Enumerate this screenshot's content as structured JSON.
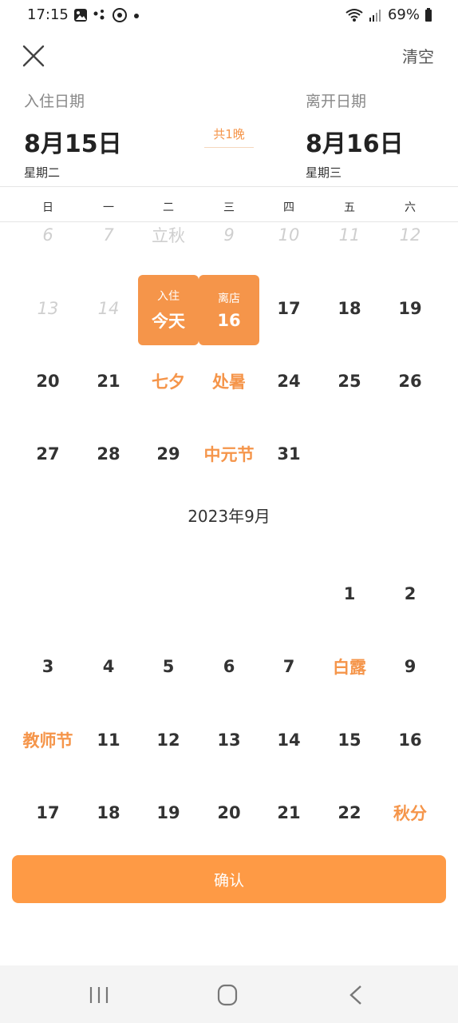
{
  "status_bar": {
    "time": "17:15",
    "battery": "69%"
  },
  "topbar": {
    "clear_label": "清空"
  },
  "checkin": {
    "label": "入住日期",
    "date": "8月15日",
    "weekday": "星期二"
  },
  "checkout": {
    "label": "离开日期",
    "date": "8月16日",
    "weekday": "星期三"
  },
  "nights": "共1晚",
  "weekdays": [
    "日",
    "一",
    "二",
    "三",
    "四",
    "五",
    "六"
  ],
  "august": {
    "rows": [
      [
        {
          "t": "6",
          "s": "past"
        },
        {
          "t": "7",
          "s": "past"
        },
        {
          "t": "立秋",
          "s": "past"
        },
        {
          "t": "9",
          "s": "past"
        },
        {
          "t": "10",
          "s": "past"
        },
        {
          "t": "11",
          "s": "past"
        },
        {
          "t": "12",
          "s": "past"
        }
      ],
      [
        {
          "t": "13",
          "s": "past"
        },
        {
          "t": "14",
          "s": "past"
        },
        {
          "t": "今天",
          "s": "sel",
          "tag": "入住"
        },
        {
          "t": "16",
          "s": "sel",
          "tag": "离店"
        },
        {
          "t": "17"
        },
        {
          "t": "18"
        },
        {
          "t": "19"
        }
      ],
      [
        {
          "t": "20"
        },
        {
          "t": "21"
        },
        {
          "t": "七夕",
          "s": "fest"
        },
        {
          "t": "处暑",
          "s": "fest"
        },
        {
          "t": "24"
        },
        {
          "t": "25"
        },
        {
          "t": "26"
        }
      ],
      [
        {
          "t": "27"
        },
        {
          "t": "28"
        },
        {
          "t": "29"
        },
        {
          "t": "中元节",
          "s": "fest"
        },
        {
          "t": "31"
        },
        {
          "t": ""
        },
        {
          "t": ""
        }
      ]
    ]
  },
  "september": {
    "title": "2023年9月",
    "rows": [
      [
        {
          "t": ""
        },
        {
          "t": ""
        },
        {
          "t": ""
        },
        {
          "t": ""
        },
        {
          "t": ""
        },
        {
          "t": "1"
        },
        {
          "t": "2"
        }
      ],
      [
        {
          "t": "3"
        },
        {
          "t": "4"
        },
        {
          "t": "5"
        },
        {
          "t": "6"
        },
        {
          "t": "7"
        },
        {
          "t": "白露",
          "s": "fest"
        },
        {
          "t": "9"
        }
      ],
      [
        {
          "t": "教师节",
          "s": "fest"
        },
        {
          "t": "11"
        },
        {
          "t": "12"
        },
        {
          "t": "13"
        },
        {
          "t": "14"
        },
        {
          "t": "15"
        },
        {
          "t": "16"
        }
      ],
      [
        {
          "t": "17"
        },
        {
          "t": "18"
        },
        {
          "t": "19"
        },
        {
          "t": "20"
        },
        {
          "t": "21"
        },
        {
          "t": "22"
        },
        {
          "t": "秋分",
          "s": "fest"
        }
      ]
    ]
  },
  "confirm_label": "确认",
  "colors": {
    "accent": "#f5954a",
    "past": "#cfcfcf",
    "text": "#333333"
  }
}
